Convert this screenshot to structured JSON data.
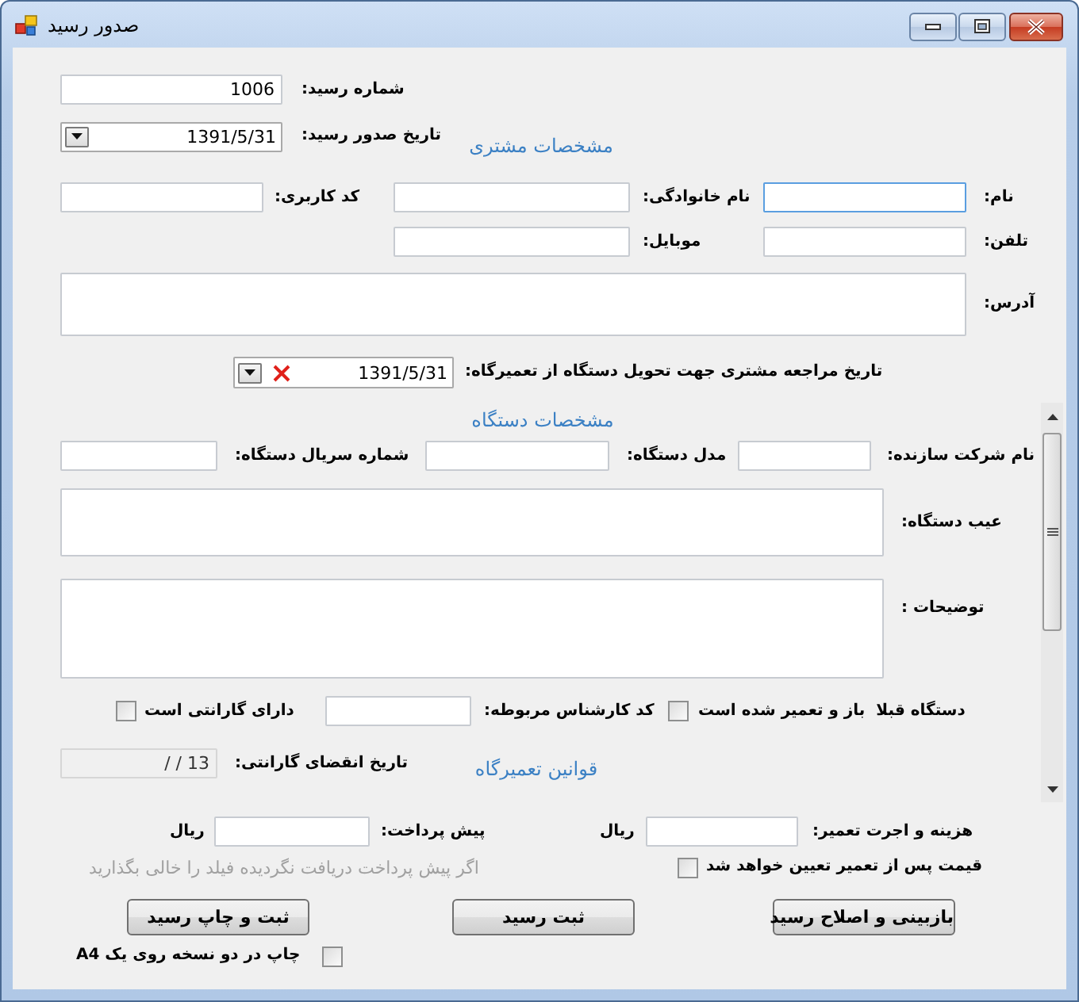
{
  "window": {
    "title": "صدور رسید"
  },
  "receipt": {
    "number_label": "شماره رسید:",
    "number": "1006",
    "date_label": "تاریخ صدور رسید:",
    "date": {
      "value": "1391/5/31",
      "clearable": false
    }
  },
  "customer": {
    "heading": "مشخصات مشتری",
    "first_name": {
      "label": "نام:",
      "focused": true
    },
    "last_name": {
      "label": "نام خانوادگی:",
      "focused": false
    },
    "user_code": {
      "label": "کد کاربری:",
      "focused": false
    },
    "phone": {
      "label": "تلفن:",
      "focused": false
    },
    "mobile": {
      "label": "موبایل:",
      "focused": false
    },
    "address": {
      "label": "آدرس:",
      "focused": false
    },
    "return_date": {
      "label": "تاریخ مراجعه مشتری جهت تحویل دستگاه از تعمیرگاه:",
      "value": "1391/5/31",
      "clearable": true
    }
  },
  "device": {
    "heading": "مشخصات دستگاه",
    "maker": {
      "label": "نام شرکت سازنده:"
    },
    "model": {
      "label": "مدل دستگاه:"
    },
    "serial": {
      "label": "شماره سریال دستگاه:"
    },
    "defect": {
      "label": "عیب دستگاه:"
    },
    "notes": {
      "label": "توضیحات :"
    },
    "repaired_before": {
      "label": "دستگاه قبلا  باز و تعمیر شده است",
      "checked": false
    },
    "technician_code": {
      "label": "کد کارشناس مربوطه:"
    },
    "has_warranty": {
      "label": "دارای گارانتی است",
      "checked": false
    },
    "warranty_expiry": {
      "label": "تاریخ انقضای گارانتی:",
      "value": "/ / 13",
      "disabled": true
    },
    "rules_heading": "قوانین تعمیرگاه"
  },
  "payment": {
    "cost": {
      "label": "هزینه و اجرت تعمیر:",
      "unit": "ریال"
    },
    "prepayment": {
      "label": "پیش پرداخت:",
      "unit": "ریال"
    },
    "price_later": {
      "label": "قیمت پس از تعمیر تعیین خواهد شد",
      "checked": false
    },
    "hint": "اگر پیش پرداخت دریافت نگردیده فیلد را خالی بگذارید"
  },
  "buttons": [
    {
      "label": "بازبینی و اصلاح رسید"
    },
    {
      "label": "ثبت رسید"
    },
    {
      "label": "ثبت و چاپ رسید"
    }
  ],
  "print_two_copies": {
    "label": "چاپ در دو نسخه روی یک A4",
    "checked": false
  }
}
